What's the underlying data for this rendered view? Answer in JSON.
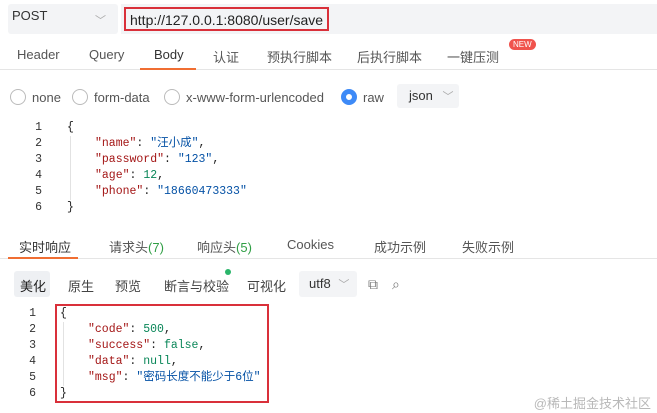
{
  "request": {
    "method": "POST",
    "url": "http://127.0.0.1:8080/user/save"
  },
  "request_tabs": [
    "Header",
    "Query",
    "Body",
    "认证",
    "预执行脚本",
    "后执行脚本",
    "一键压测"
  ],
  "new_badge": "NEW",
  "body_types": {
    "none": "none",
    "form_data": "form-data",
    "urlencoded": "x-www-form-urlencoded",
    "raw": "raw",
    "format": "json"
  },
  "request_body": {
    "line_numbers": [
      "1",
      "2",
      "3",
      "4",
      "5",
      "6"
    ],
    "open_brace": "{",
    "close_brace": "}",
    "lines": [
      {
        "key": "\"name\"",
        "value": "\"汪小成\"",
        "value_type": "string",
        "trail": ","
      },
      {
        "key": "\"password\"",
        "value": "\"123\"",
        "value_type": "string",
        "trail": ","
      },
      {
        "key": "\"age\"",
        "value": "12",
        "value_type": "number",
        "trail": ","
      },
      {
        "key": "\"phone\"",
        "value": "\"18660473333\"",
        "value_type": "string",
        "trail": ""
      }
    ]
  },
  "response_tabs": {
    "realtime": "实时响应",
    "req_headers": "请求头",
    "req_headers_count": "(7)",
    "resp_headers": "响应头",
    "resp_headers_count": "(5)",
    "cookies": "Cookies",
    "success_example": "成功示例",
    "fail_example": "失败示例"
  },
  "response_toolbar": {
    "beautify": "美化",
    "raw": "原生",
    "preview": "预览",
    "assert": "断言与校验",
    "visualize": "可视化",
    "encoding": "utf8",
    "copy_icon": "copy-icon",
    "search_icon": "search-icon"
  },
  "response_body": {
    "line_numbers": [
      "1",
      "2",
      "3",
      "4",
      "5",
      "6"
    ],
    "open_brace": "{",
    "close_brace": "}",
    "lines": [
      {
        "key": "\"code\"",
        "value": "500",
        "value_type": "number",
        "trail": ","
      },
      {
        "key": "\"success\"",
        "value": "false",
        "value_type": "number",
        "trail": ","
      },
      {
        "key": "\"data\"",
        "value": "null",
        "value_type": "number",
        "trail": ","
      },
      {
        "key": "\"msg\"",
        "value": "\"密码长度不能少于6位\"",
        "value_type": "string",
        "trail": ""
      }
    ]
  },
  "watermark": "@稀土掘金技术社区",
  "colors": {
    "accent_orange": "#f06e32",
    "radio_blue": "#3d8af7",
    "highlight_red": "#d9303a",
    "json_key": "#a31515",
    "json_string": "#0451a5",
    "json_number": "#098658"
  }
}
